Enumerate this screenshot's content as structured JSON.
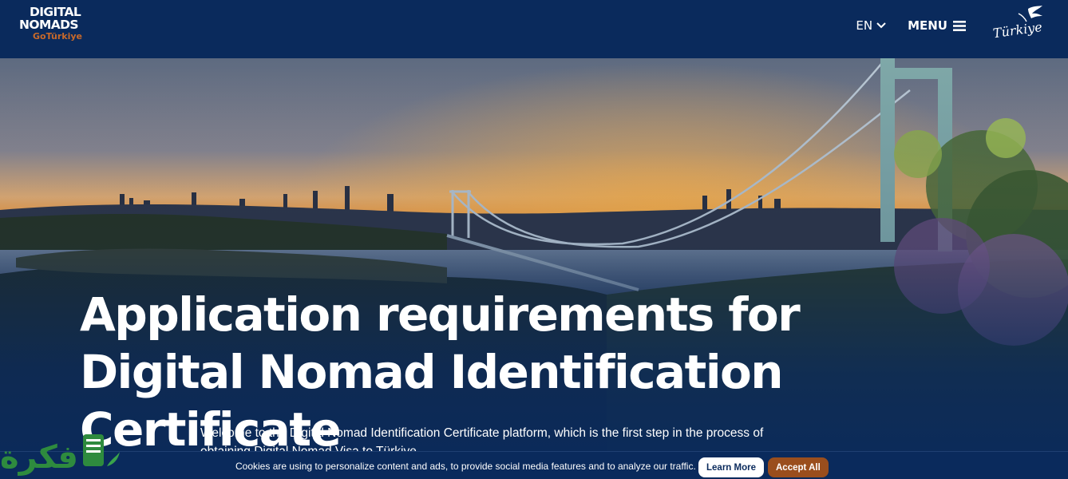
{
  "header": {
    "brand_line1": "DIGITAL",
    "brand_line2": "NOMADS",
    "brand_line3": "GoTürkiye",
    "language": "EN",
    "menu_label": "MENU",
    "turkiye_logo_text": "Türkiye"
  },
  "hero": {
    "title": "Application requirements for Digital Nomad Identification Certificate",
    "intro": "Welcome to the Digital Nomad Identification Certificate platform, which is the first step in the process of obtaining Digital Nomad Visa to Türkiye."
  },
  "cookie": {
    "text": "Cookies are using to personalize content and ads, to provide social media features and to analyze our traffic.",
    "learn_more": "Learn More",
    "accept_all": "Accept All"
  },
  "watermark": {
    "text": "فكرة"
  },
  "colors": {
    "navy": "#0a2a5c",
    "brand_orange": "#c8692a",
    "accept_button": "#9a4e1d",
    "watermark_green": "#2e8b3e"
  },
  "icons": {
    "language_chevron": "chevron-down-icon",
    "menu": "hamburger-menu-icon",
    "turkiye_logo": "turkiye-bird-logo"
  }
}
